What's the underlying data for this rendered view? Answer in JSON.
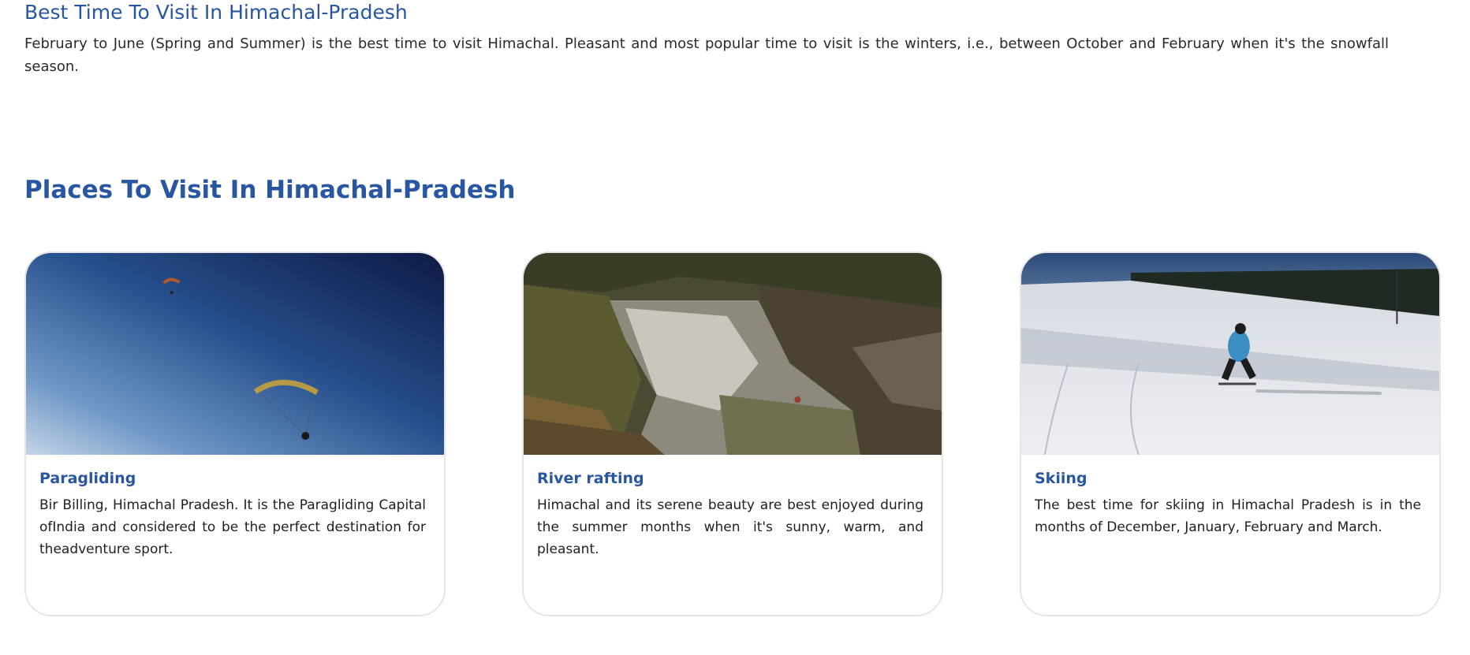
{
  "best_time": {
    "heading": "Best Time To Visit In Himachal-Pradesh",
    "body": "February to June (Spring and Summer) is the best time to visit Himachal. Pleasant and most popular time to visit is the winters, i.e., between October and February when it's the snowfall season."
  },
  "places": {
    "heading": "Places To Visit In Himachal-Pradesh",
    "cards": [
      {
        "title": "Paragliding",
        "description": "Bir Billing, Himachal Pradesh. It is the Paragliding Capital ofIndia and considered to be the perfect destination for theadventure sport."
      },
      {
        "title": "River rafting",
        "description": "Himachal and its serene beauty are best enjoyed during the summer months when it's sunny, warm, and pleasant."
      },
      {
        "title": "Skiing",
        "description": "The best time for skiing in Himachal Pradesh is in the months of December, January, February and March."
      }
    ]
  }
}
